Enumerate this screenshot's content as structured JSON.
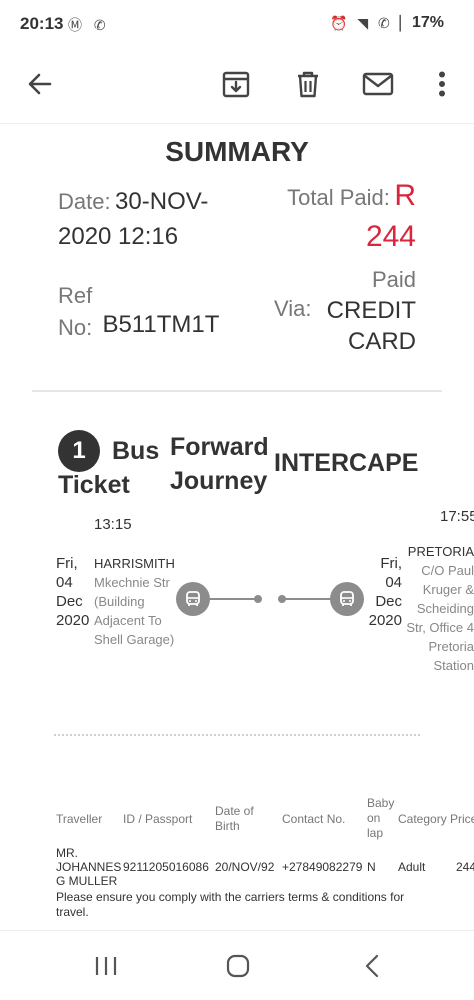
{
  "status_bar": {
    "time": "20:13",
    "app_icons": "Ⓜ ✆",
    "system_icons": "⏰ ◥ ✆ ▏",
    "battery": "17%"
  },
  "toolbar": {
    "back_icon": "arrow-left-icon",
    "archive_icon": "archive-icon",
    "delete_icon": "trash-icon",
    "mail_icon": "mail-icon",
    "more_icon": "more-vertical-icon"
  },
  "summary": {
    "title": "SUMMARY",
    "date_label": "Date:",
    "date_value": "30-NOV-2020 12:16",
    "total_label": "Total Paid:",
    "total_value": "R 244",
    "ref_label": "Ref No:",
    "ref_value": "B511TM1T",
    "paid_label": "Paid",
    "via_label": "Via:",
    "via_value": "CREDIT CARD"
  },
  "ticket": {
    "number": "1",
    "type_line1": "Bus",
    "type_line2": "Ticket",
    "journey": "Forward Journey",
    "carrier": "INTERCAPE",
    "departure": {
      "time": "13:15",
      "date": "Fri, 04 Dec 2020",
      "city": "HARRISMITH",
      "address": "Mkechnie Str (Building Adjacent To Shell Garage)"
    },
    "arrival": {
      "time": "17:55",
      "date": "Fri, 04 Dec 2020",
      "city": "PRETORIA",
      "address": "C/O Paul Kruger & Scheiding Str, Office 4 Pretoria Station"
    }
  },
  "passengers": {
    "headers": [
      "Traveller",
      "ID / Passport",
      "Date of Birth",
      "Contact No.",
      "Baby on lap",
      "Category",
      "Price"
    ],
    "rows": [
      {
        "traveller": "MR. JOHANNES G MULLER",
        "id": "9211205016086",
        "dob": "20/NOV/92",
        "contact": "+27849082279",
        "baby": "N",
        "category": "Adult",
        "price": "244"
      }
    ],
    "notice": "Please ensure you comply with the carriers terms & conditions for travel."
  },
  "colors": {
    "accent_red": "#d7263d",
    "text_dark": "#333333",
    "text_grey": "#777777"
  }
}
